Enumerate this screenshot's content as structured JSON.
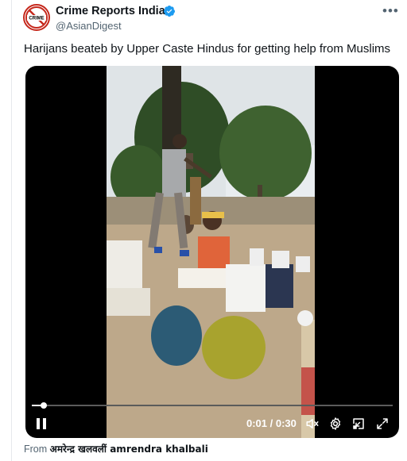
{
  "account": {
    "name": "Crime Reports India",
    "handle": "@AsianDigest",
    "avatar_text": "CRIME",
    "verified": true
  },
  "tweet": {
    "text": "Harijans beateb by Upper Caste Hindus for getting help from Muslims"
  },
  "video": {
    "time_display": "0:01 / 0:30",
    "progress": 0.033
  },
  "attribution": {
    "prefix": "From",
    "source": "अमरेन्द्र खलवलीं amrendra khalbali"
  },
  "colors": {
    "verified_blue": "#1d9bf0",
    "avatar_red": "#c5281c",
    "secondary_text": "#536471"
  },
  "icons": [
    "verified-badge-icon",
    "more-icon",
    "pause-icon",
    "volume-muted-icon",
    "settings-gear-icon",
    "picture-in-picture-icon",
    "fullscreen-icon"
  ]
}
